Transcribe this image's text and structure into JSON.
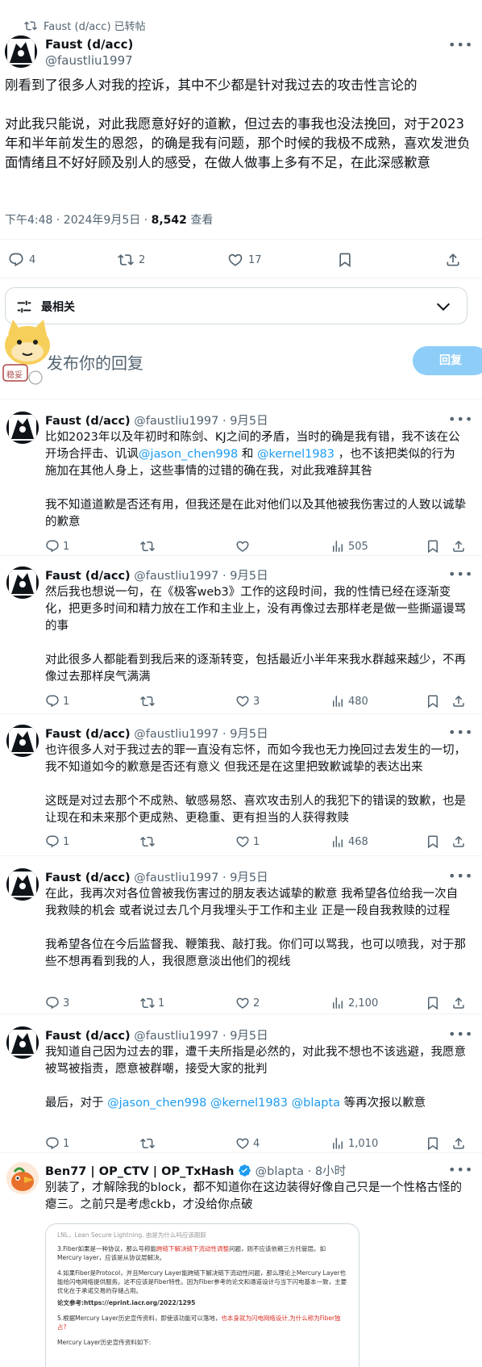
{
  "main_tweet": {
    "retweeted_by": "Faust (d/acc) 已转帖",
    "author_name": "Faust (d/acc)",
    "author_handle": "@faustliu1997",
    "paragraphs": [
      "刚看到了很多人对我的控诉，其中不少都是针对我过去的攻击性言论的",
      "对此我只能说，对此我愿意好好的道歉，但过去的事我也没法挽回，对于2023年和半年前发生的恩怨，的确是我有问题，那个时候的我极不成熟，喜欢发泄负面情绪且不好好顾及别人的感受，在做人做事上多有不足，在此深感歉意"
    ],
    "timestamp": "下午4:48 · 2024年9月5日 · ",
    "views": "8,542",
    "views_label": " 查看",
    "replies": "4",
    "retweets": "2",
    "likes": "17"
  },
  "sort": {
    "label": "最相关"
  },
  "compose": {
    "placeholder": "发布你的回复",
    "reply_button": "回复",
    "sticker_text": "稳妥"
  },
  "replies": [
    {
      "name": "Faust (d/acc)",
      "handle": "@faustliu1997 · 9月5日",
      "para1_a": "比如2023年以及年初时和陈剑、KJ之间的矛盾，当时的确是我有错，我不该在公开场合抨击、讥讽",
      "mention1": "@jason_chen998",
      "para1_b": " 和 ",
      "mention2": "@kernel1983",
      "para1_c": " ，也不该把类似的行为施加在其他人身上，这些事情的过错的确在我，对此我难辞其咎",
      "para2": "我不知道道歉是否还有用，但我还是在此对他们以及其他被我伤害过的人致以诚挚的歉意",
      "replies": "1",
      "retweets": "",
      "likes": "",
      "views": "505"
    },
    {
      "name": "Faust (d/acc)",
      "handle": "@faustliu1997 · 9月5日",
      "para1": "然后我也想说一句，在《极客web3》工作的这段时间，我的性情已经在逐渐变化，把更多时间和精力放在工作和主业上，没有再像过去那样老是做一些撕逼谩骂的事",
      "para2": "对此很多人都能看到我后来的逐渐转变，包括最近小半年来我水群越来越少，不再像过去那样戾气满满",
      "replies": "1",
      "retweets": "",
      "likes": "3",
      "views": "480"
    },
    {
      "name": "Faust (d/acc)",
      "handle": "@faustliu1997 · 9月5日",
      "para1": "也许很多人对于我过去的罪一直没有忘怀，而如今我也无力挽回过去发生的一切，我不知道如今的歉意是否还有意义 但我还是在这里把致歉诚挚的表达出来",
      "para2": "这既是对过去那个不成熟、敏感易怒、喜欢攻击别人的我犯下的错误的致歉，也是让现在和未来那个更成熟、更稳重、更有担当的人获得救赎",
      "replies": "1",
      "retweets": "",
      "likes": "1",
      "views": "468"
    },
    {
      "name": "Faust (d/acc)",
      "handle": "@faustliu1997 · 9月5日",
      "para1": "在此，我再次对各位曾被我伤害过的朋友表达诚挚的歉意 我希望各位给我一次自我救赎的机会 或者说过去几个月我埋头于工作和主业 正是一段自我救赎的过程",
      "para2": "我希望各位在今后监督我、鞭策我、敲打我。你们可以骂我，也可以喷我，对于那些不想再看到我的人，我很愿意淡出他们的视线",
      "replies": "3",
      "retweets": "1",
      "likes": "2",
      "views": "2,100"
    },
    {
      "name": "Faust (d/acc)",
      "handle": "@faustliu1997 · 9月5日",
      "para1": "我知道自己因为过去的罪，遭千夫所指是必然的，对此我不想也不该逃避，我愿意被骂被指责，愿意被群嘲，接受大家的批判",
      "para2_a": "最后，对于 ",
      "m1": "@jason_chen998",
      "m2": "@kernel1983",
      "m3": "@blapta",
      "para2_b": " 等再次报以歉意",
      "replies": "1",
      "retweets": "",
      "likes": "4",
      "views": "1,010"
    },
    {
      "name": "Ben77 | OP_CTV | OP_TxHash",
      "handle": "@blapta · 8小时",
      "body": "别装了，才解除我的block，都不知道你在这边装得好像自己只是一个性格古怪的瘪三。之前只是考虑ckb，才没给你点破"
    }
  ],
  "embed_doc": {
    "line0": "LNL，Lean Secure Lightning. 由是为什么吗应该跟踪",
    "line1a": "3.Fiber如果是一种协议，那么号称能",
    "line1b": "跨链下解决链下流动性调整",
    "line1c": "问题，则不应该依赖三方托管层。如Mercury layer，应该是从协议层解决。",
    "line2": "4.如果Fiber是Protocol，并且Mercury Layer能跨链下解决链下流动性问题，那么理论上Mercury Layer也能给闪电网络提供服务。这不应该是Fiber特性。因为Fiber参考的论文和通道设计与当下闪电基本一致，主要优化在于承诺交易的存储占用。",
    "line3": "论文参考:https://eprint.iacr.org/2022/1295",
    "line4a": "5.根据Mercury Layer历史宣传资料，即使该功能可以落地，",
    "line4b": "也本身就为闪电网络设计,为什么称为Fiber独占?",
    "line5": "Mercury Layer历史宣传资料如下:"
  }
}
